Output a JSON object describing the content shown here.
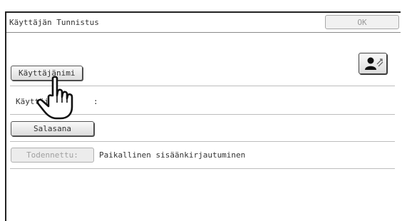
{
  "dialog": {
    "title": "Käyttäjän Tunnistus",
    "ok_label": "OK"
  },
  "form": {
    "username_button_label": "Käyttäjänimi",
    "username_field_label": "Käyttäjänimi",
    "username_field_separator": ":",
    "username_value": "",
    "password_button_label": "Salasana",
    "auth_button_label": "Todennettu:",
    "auth_value": "Paikallinen sisäänkirjautuminen"
  },
  "icons": {
    "user_icon": "user-switch-icon",
    "pointer": "hand-pointer-icon"
  },
  "colors": {
    "accent_border": "#222222",
    "disabled_text": "#9a9a9a",
    "text": "#333333"
  }
}
